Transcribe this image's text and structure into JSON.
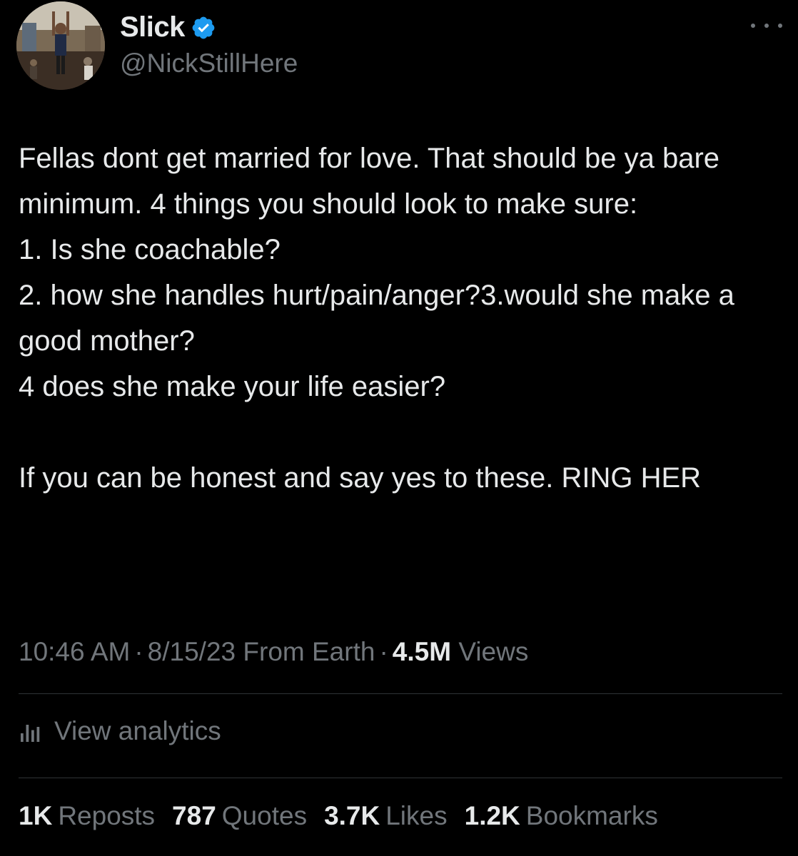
{
  "author": {
    "name": "Slick",
    "handle": "@NickStillHere",
    "verified_color": "#1d9bf0"
  },
  "tweet": {
    "text": "Fellas dont get married for love. That should be ya bare minimum. 4 things you should look to make sure:\n1. Is she coachable?\n2. how she handles hurt/pain/anger?3.would she make a good mother?\n4 does she make your life easier?\n\nIf you can be honest and say yes to these. RING HER"
  },
  "meta": {
    "time": "10:46 AM",
    "date": "8/15/23",
    "source": "From Earth",
    "views_count": "4.5M",
    "views_label": "Views",
    "separator": "·"
  },
  "analytics": {
    "label": "View analytics",
    "icon": "bar-chart-icon"
  },
  "stats": [
    {
      "count": "1K",
      "label": "Reposts"
    },
    {
      "count": "787",
      "label": "Quotes"
    },
    {
      "count": "3.7K",
      "label": "Likes"
    },
    {
      "count": "1.2K",
      "label": "Bookmarks"
    }
  ],
  "colors": {
    "background": "#000000",
    "text_primary": "#e7e9ea",
    "text_secondary": "#71767b",
    "divider": "#2f3336"
  }
}
